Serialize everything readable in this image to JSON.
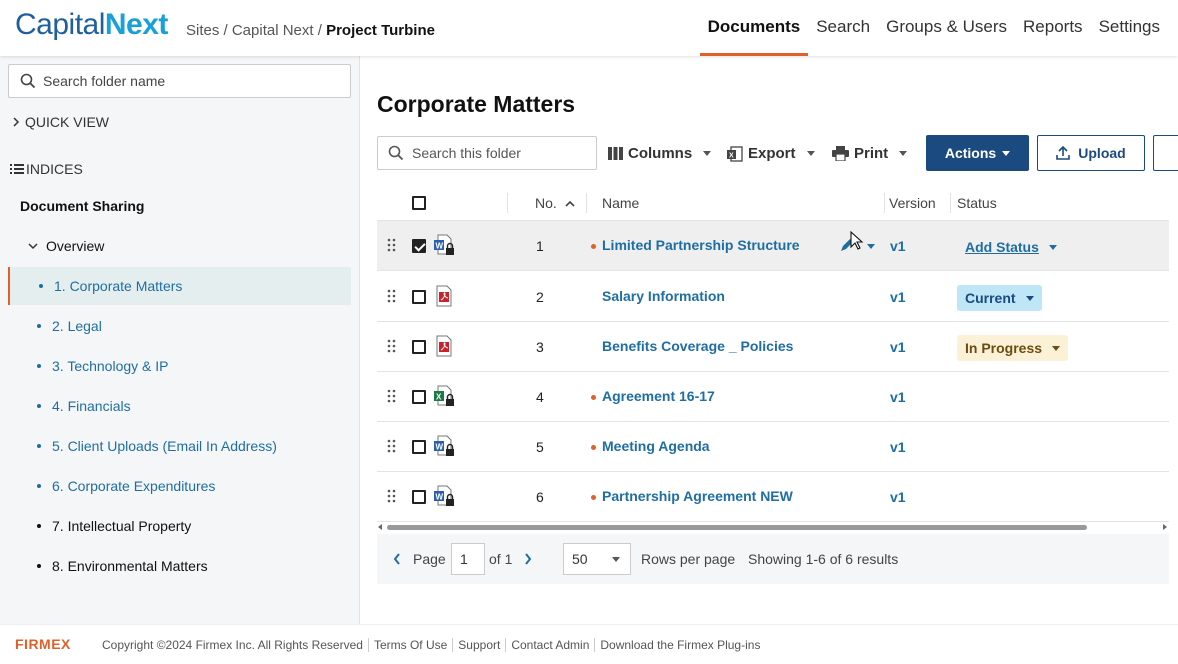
{
  "header": {
    "logo_part1": "Capital",
    "logo_part2": "Next",
    "breadcrumb_prefix": "Sites / Capital Next / ",
    "breadcrumb_current": "Project Turbine",
    "nav": [
      "Documents",
      "Search",
      "Groups & Users",
      "Reports",
      "Settings"
    ],
    "active_nav": "Documents"
  },
  "sidebar": {
    "search_placeholder": "Search folder name",
    "quick_view": "QUICK VIEW",
    "indices": "INDICES",
    "root": "Document Sharing",
    "overview": "Overview",
    "items": [
      "1. Corporate Matters",
      "2. Legal",
      "3. Technology & IP",
      "4. Financials",
      "5. Client Uploads (Email In Address)",
      "6. Corporate Expenditures",
      "7. Intellectual Property",
      "8. Environmental Matters"
    ]
  },
  "main": {
    "title": "Corporate Matters",
    "search_placeholder": "Search this folder",
    "toolbar": {
      "columns": "Columns",
      "export": "Export",
      "print": "Print",
      "actions": "Actions",
      "upload": "Upload"
    },
    "columns": [
      "No.",
      "Name",
      "Version",
      "Status"
    ],
    "rows": [
      {
        "no": "1",
        "name": "Limited Partnership Structure",
        "version": "v1",
        "status": "Add Status",
        "file_type": "word-locked-icon",
        "checked": true
      },
      {
        "no": "2",
        "name": "Salary Information",
        "version": "v1",
        "status": "Current",
        "file_type": "pdf-icon",
        "checked": false
      },
      {
        "no": "3",
        "name": "Benefits Coverage _ Policies",
        "version": "v1",
        "status": "In Progress",
        "file_type": "pdf-icon",
        "checked": false
      },
      {
        "no": "4",
        "name": "Agreement 16-17",
        "version": "v1",
        "status": "",
        "file_type": "excel-locked-icon",
        "checked": false
      },
      {
        "no": "5",
        "name": "Meeting Agenda",
        "version": "v1",
        "status": "",
        "file_type": "word-locked-icon",
        "checked": false
      },
      {
        "no": "6",
        "name": "Partnership Agreement NEW",
        "version": "v1",
        "status": "",
        "file_type": "word-locked-icon",
        "checked": false
      }
    ],
    "pager": {
      "page_label": "Page",
      "page_value": "1",
      "of_label": "of 1",
      "rows_per_page_value": "50",
      "rows_per_page_label": "Rows per page",
      "showing": "Showing 1-6 of 6 results"
    }
  },
  "footer": {
    "brand": "FIRMEX",
    "links": [
      "Copyright ©2024 Firmex Inc. All Rights Reserved",
      "Terms Of Use",
      "Support",
      "Contact Admin",
      "Download the Firmex Plug-ins"
    ]
  },
  "colors": {
    "accent": "#e0602a",
    "primary": "#1a4a80",
    "link": "#1f6ea3"
  }
}
